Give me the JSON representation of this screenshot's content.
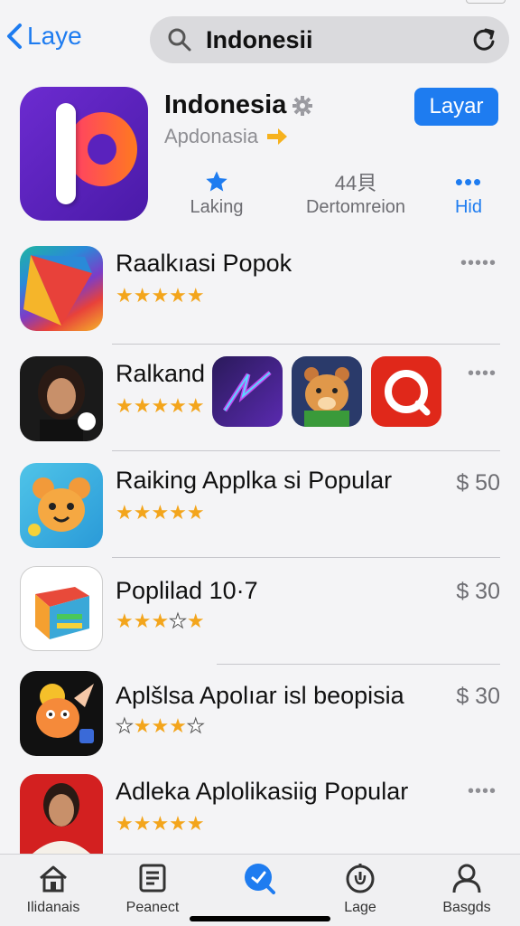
{
  "header": {
    "back_label": "Laye",
    "search_value": "Indonesii"
  },
  "featured": {
    "title": "Indonesia",
    "subtitle": "Apdonasia",
    "get_label": "Layar",
    "stats": [
      {
        "label": "Laking"
      },
      {
        "value": "44貝",
        "label": "Dertomreion"
      },
      {
        "label": "Hid"
      }
    ],
    "icon_color": "#6c2bd0"
  },
  "apps": [
    {
      "name": "Raalkıasi Popok",
      "rating": 5,
      "trailing": "more"
    },
    {
      "name": "Ralkand",
      "rating": 5,
      "trailing": "more"
    },
    {
      "name": "Raiking Applka si Popular",
      "rating": 5,
      "price": "$ 50"
    },
    {
      "name": "Poplilad 10·7",
      "rating": 3,
      "price": "$ 30"
    },
    {
      "name": "Aplšlsa Apolıar isl beopisia",
      "rating": 3,
      "price": "$ 30"
    },
    {
      "name": "Adleka Aplolikasiig Popular",
      "rating": 5,
      "trailing": "more"
    }
  ],
  "tabs": [
    {
      "label": "Ilidanais",
      "icon": "home-icon"
    },
    {
      "label": "Peanect",
      "icon": "news-icon"
    },
    {
      "label": "",
      "icon": "search-active-icon"
    },
    {
      "label": "Lage",
      "icon": "clock-icon"
    },
    {
      "label": "Basgds",
      "icon": "person-icon"
    }
  ],
  "colors": {
    "accent": "#1e7cf0",
    "star": "#f3a51c",
    "price": "#6d6d72"
  }
}
